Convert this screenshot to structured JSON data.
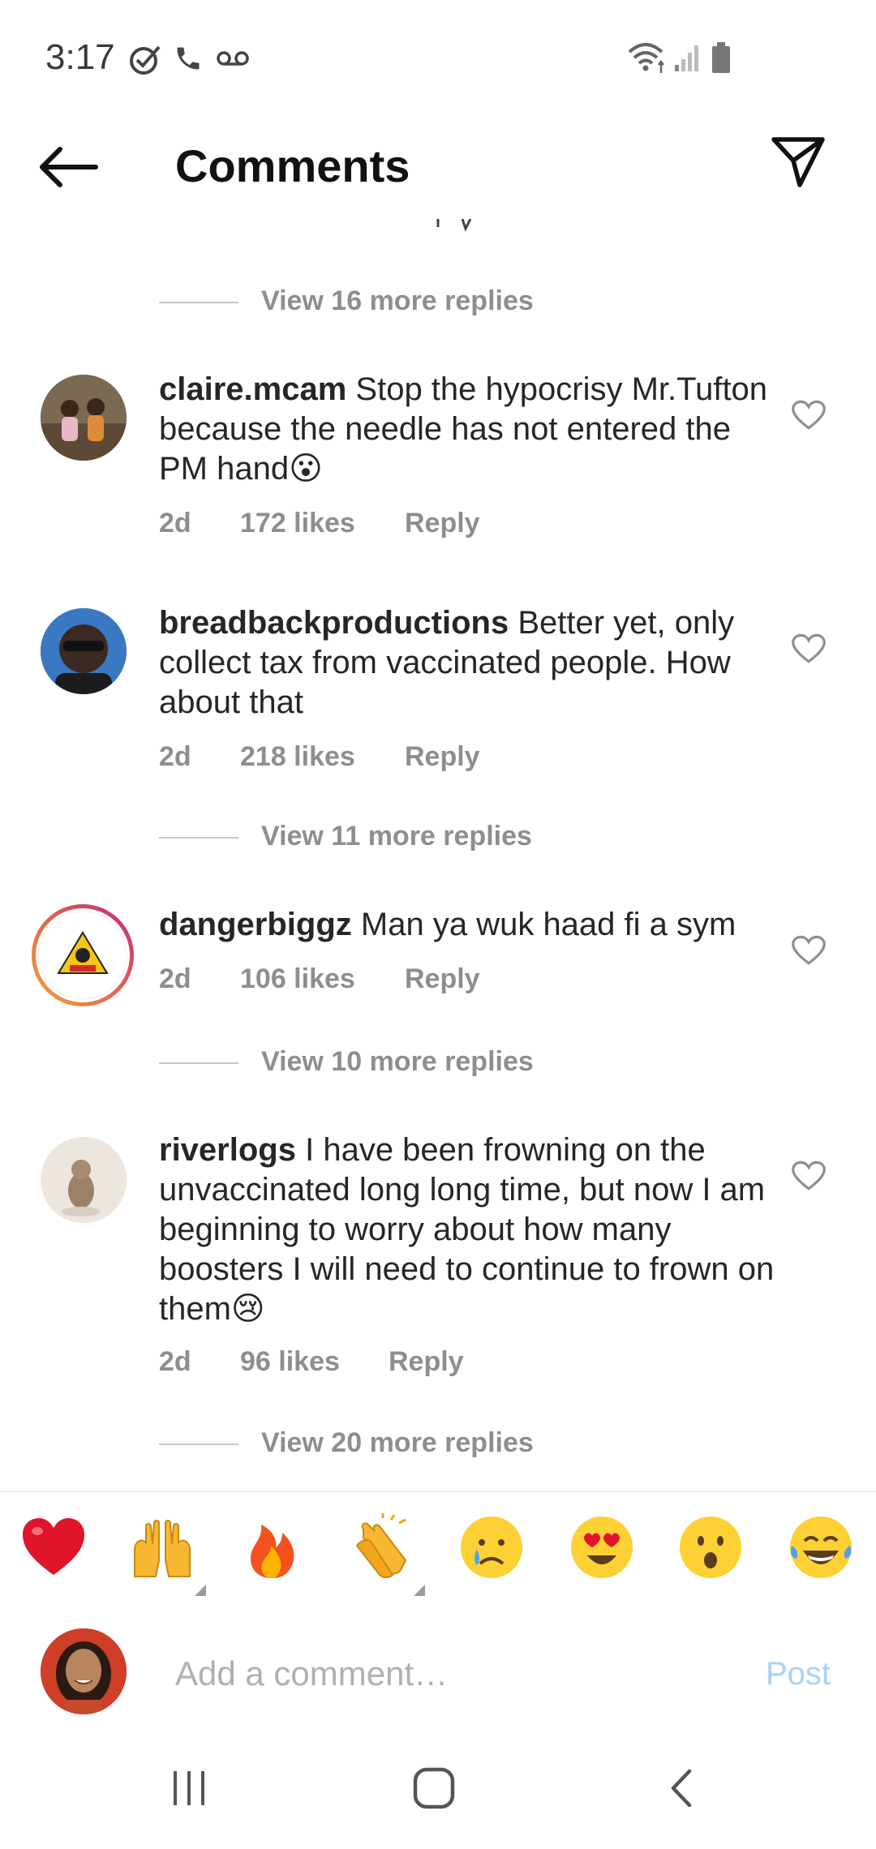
{
  "status_bar": {
    "time": "3:17",
    "left_icons": [
      "check-circle-icon",
      "phone-icon",
      "voicemail-icon"
    ],
    "right_icons": [
      "wifi-icon",
      "signal-icon",
      "battery-icon"
    ]
  },
  "header": {
    "title": "Comments",
    "back_icon": "back-arrow-icon",
    "share_icon": "send-icon"
  },
  "comments": [
    {
      "username": "claire.mcam",
      "text": "Stop the hypocrisy Mr.Tufton because the needle has not entered the PM hand😮",
      "time": "2d",
      "likes": "172 likes",
      "reply": "Reply"
    },
    {
      "username": "breadbackproductions",
      "text": "Better yet, only collect tax from vaccinated people. How about that",
      "time": "2d",
      "likes": "218 likes",
      "reply": "Reply"
    },
    {
      "username": "dangerbiggz",
      "text": "Man ya wuk haad fi a sym",
      "time": "2d",
      "likes": "106 likes",
      "reply": "Reply"
    },
    {
      "username": "riverlogs",
      "text": "I have been frowning on the unvaccinated long long time, but now I am beginning to worry about how many boosters I will need to continue to frown on them😢",
      "time": "2d",
      "likes": "96 likes",
      "reply": "Reply"
    }
  ],
  "view_replies": [
    "View 16 more replies",
    "View 11 more replies",
    "View 10 more replies",
    "View 20 more replies"
  ],
  "emoji_bar": [
    "❤️",
    "🙌",
    "🔥",
    "👏",
    "😢",
    "😍",
    "😮",
    "😂"
  ],
  "composer": {
    "placeholder": "Add a comment…",
    "post_label": "Post"
  },
  "colors": {
    "post_disabled": "#a8d3f5",
    "story_ring_start": "#f9a13a",
    "story_ring_end": "#c7286e"
  }
}
